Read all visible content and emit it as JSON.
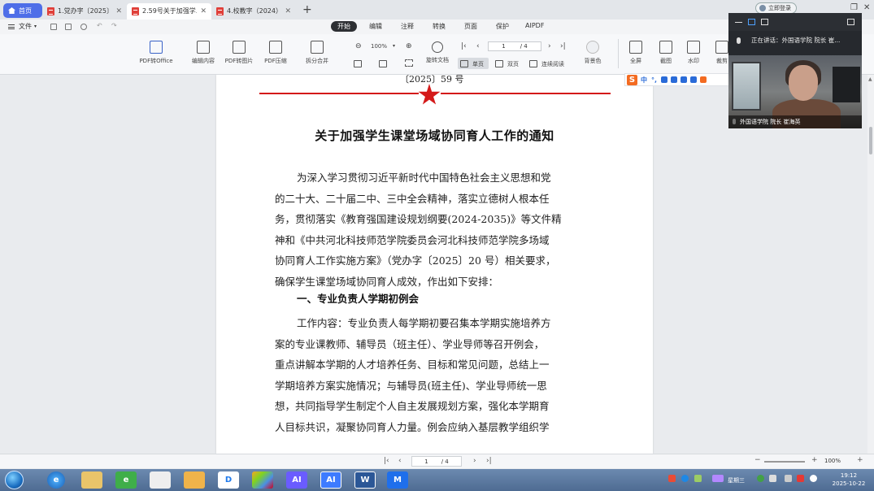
{
  "tabs": [
    {
      "label": "首页",
      "kind": "home"
    },
    {
      "label": "1.党办字〔2025〕...",
      "kind": "pdf"
    },
    {
      "label": "2.59号关于加强学...",
      "kind": "pdf",
      "active": true
    },
    {
      "label": "4.校教字（2024）...",
      "kind": "pdf"
    }
  ],
  "titlebar": {
    "new_tab": "+",
    "login": "立即登录"
  },
  "menubar": {
    "file": "文件",
    "items": [
      "开始",
      "编辑",
      "注释",
      "转换",
      "页面",
      "保护",
      "AIPDF"
    ],
    "active": "开始"
  },
  "ribbon": {
    "pdf_to_office": "PDF转Office",
    "edit_content": "编辑内容",
    "pdf_to_image": "PDF转图片",
    "pdf_compress": "PDF压缩",
    "split_merge": "拆分合并",
    "zoom": "100%",
    "rotate": "旋转文档",
    "single_page": "单页",
    "double_page": "双页",
    "continuous": "连续阅读",
    "background": "背景色",
    "fullscreen": "全屏",
    "screenshot": "截图",
    "watermark": "水印",
    "crop": "裁剪",
    "page_current": "1",
    "page_total": "/ 4"
  },
  "document": {
    "doc_number": "〔2025〕59 号",
    "title": "关于加强学生课堂场域协同育人工作的通知",
    "intro_lines": [
      "为深入学习贯彻习近平新时代中国特色社会主义思想和党",
      "的二十大、二十届二中、三中全会精神，落实立德树人根本任",
      "务，贯彻落实《教育强国建设规划纲要(2024-2035)》等文件精",
      "神和《中共河北科技师范学院委员会河北科技师范学院多场域",
      "协同育人工作实施方案》（党办字〔2025〕20 号）相关要求，",
      "确保学生课堂场域协同育人成效，作出如下安排："
    ],
    "heading1": "一、专业负责人学期初例会",
    "section1_lines": [
      "工作内容：专业负责人每学期初要召集本学期实施培养方",
      "案的专业课教师、辅导员（班主任）、学业导师等召开例会，",
      "重点讲解本学期的人才培养任务、目标和常见问题，总结上一",
      "学期培养方案实施情况；与辅导员(班主任)、学业导师统一思",
      "想，共同指导学生制定个人自主发展规划方案，强化本学期育",
      "人目标共识，凝聚协同育人力量。例会应纳入基层教学组织学"
    ]
  },
  "ime": {
    "lang": "中",
    "punct": "°,"
  },
  "video": {
    "speaking": "正在讲话：外国语学院 院长 崔...",
    "caption": "外国语学院 院长 崔海英"
  },
  "statusbar": {
    "page_current": "1",
    "page_total": "/ 4",
    "zoom": "100%"
  },
  "taskbar": {
    "weekday": "星期三",
    "time": "19:12",
    "date": "2025-10-22"
  },
  "colors": {
    "accent": "#4e6ee8",
    "seal_red": "#d41a1a",
    "pdf_red": "#e0403a"
  }
}
